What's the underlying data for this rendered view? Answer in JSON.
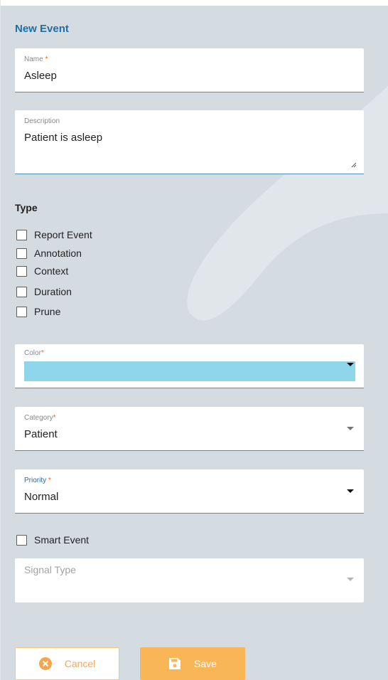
{
  "form": {
    "title": "New Event",
    "name": {
      "label": "Name",
      "required": "*",
      "value": "Asleep"
    },
    "description": {
      "label": "Description",
      "value": "Patient is asleep"
    },
    "type": {
      "title": "Type",
      "options": [
        "Report Event",
        "Annotation",
        "Context",
        "Duration",
        "Prune"
      ]
    },
    "color": {
      "label": "Color",
      "required": "*",
      "value_color": "#8fd6ea"
    },
    "category": {
      "label": "Category",
      "required": "*",
      "value": "Patient"
    },
    "priority": {
      "label": "Priority",
      "required": "*",
      "value": "Normal"
    },
    "smart_event": {
      "label": "Smart Event"
    },
    "signal_type": {
      "placeholder": "Signal Type"
    }
  },
  "actions": {
    "cancel_label": "Cancel",
    "save_label": "Save"
  },
  "colors": {
    "accent": "#1f6fa3",
    "button_orange": "#f9b657",
    "background": "#d4dce2"
  },
  "icons": {
    "cancel": "x-circle-icon",
    "save": "floppy-disk-icon",
    "select": "caret-down-icon"
  }
}
